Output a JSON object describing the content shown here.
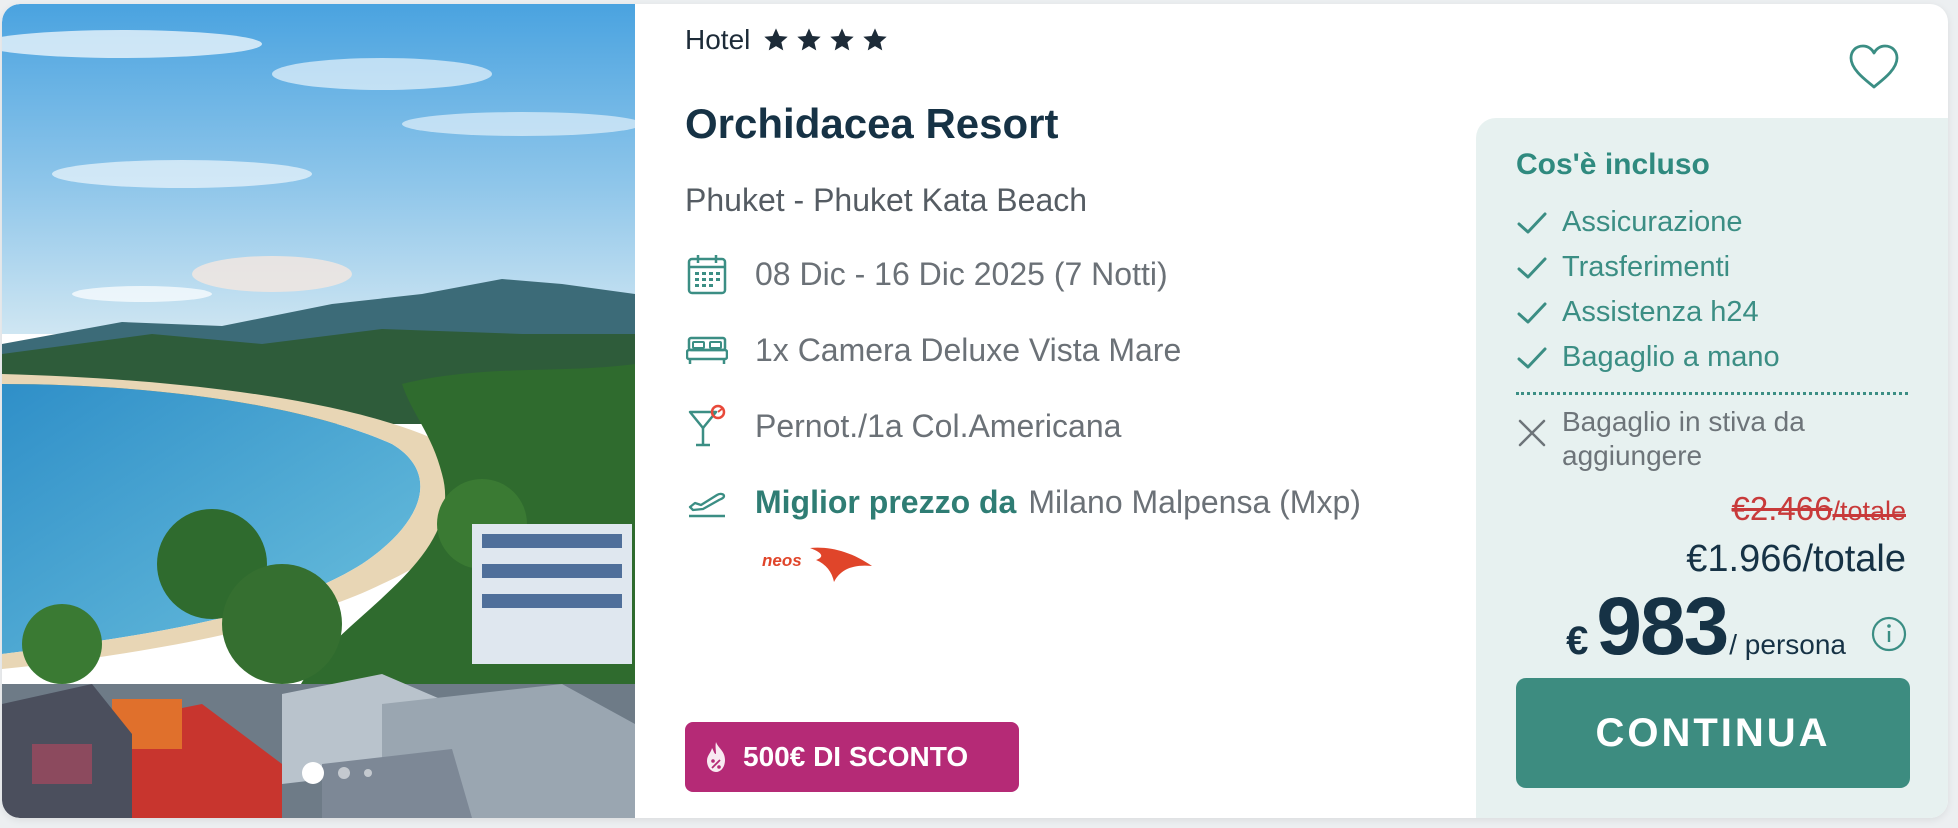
{
  "hotel": {
    "category_label": "Hotel",
    "stars": 4,
    "name": "Orchidacea Resort",
    "location": "Phuket - Phuket Kata Beach"
  },
  "details": {
    "dates": "08 Dic - 16 Dic 2025 (7 Notti)",
    "room": "1x Camera Deluxe Vista Mare",
    "board": "Pernot./1a Col.Americana",
    "best_price_label": "Miglior prezzo da",
    "departure_airport": "Milano Malpensa (Mxp)",
    "airline": "neos"
  },
  "discount_badge": "500€ DI SCONTO",
  "gallery": {
    "slide_count": 3,
    "active_slide": 1
  },
  "included": {
    "title": "Cos'è incluso",
    "items": [
      "Assicurazione",
      "Trasferimenti",
      "Assistenza h24",
      "Bagaglio a mano"
    ],
    "excluded": [
      "Bagaglio in stiva da aggiungere"
    ]
  },
  "price": {
    "old_total": "€2.466",
    "old_total_unit": "/totale",
    "total": "€1.966/totale",
    "currency_symbol": "€",
    "per_person": "983",
    "per_person_unit": "/ persona"
  },
  "cta_label": "CONTINUA",
  "colors": {
    "accent": "#3d8c80",
    "title": "#163245",
    "discount": "#b52a76",
    "old_price": "#c83a3a",
    "panel_bg": "#e7f1f0"
  }
}
